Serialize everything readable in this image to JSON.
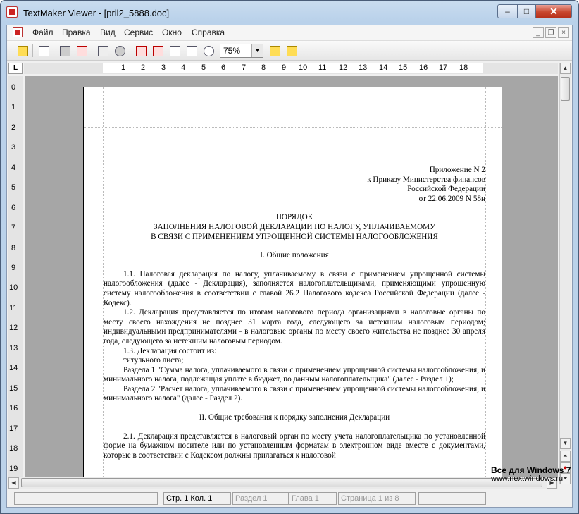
{
  "window": {
    "title": "TextMaker Viewer - [pril2_5888.doc]",
    "min": "–",
    "max": "□",
    "close": "✕"
  },
  "menu": [
    "Файл",
    "Правка",
    "Вид",
    "Сервис",
    "Окно",
    "Справка"
  ],
  "mdi": {
    "min": "_",
    "restore": "❐",
    "close": "×"
  },
  "toolbar": {
    "zoom": "75%",
    "icons": [
      "open-icon",
      "new-page-icon",
      "print-icon",
      "pdf-icon",
      "copy-icon",
      "find-icon",
      "single-page-icon",
      "two-page-icon",
      "page-width-icon",
      "multi-page-icon",
      "zoom-icon",
      "ruler-h-icon",
      "ruler-v-icon"
    ]
  },
  "ruler": {
    "corner": "L",
    "h": [
      "1",
      "2",
      "3",
      "4",
      "5",
      "6",
      "7",
      "8",
      "9",
      "10",
      "11",
      "12",
      "13",
      "14",
      "15",
      "16",
      "17",
      "18"
    ],
    "v": [
      "0",
      "1",
      "2",
      "3",
      "4",
      "5",
      "6",
      "7",
      "8",
      "9",
      "10",
      "11",
      "12",
      "13",
      "14",
      "15",
      "16",
      "17",
      "18",
      "19"
    ]
  },
  "doc": {
    "appendix": [
      "Приложение N 2",
      "к Приказу Министерства финансов",
      "Российской Федерации",
      "от 22.06.2009 N 58н"
    ],
    "title": [
      "ПОРЯДОК",
      "ЗАПОЛНЕНИЯ НАЛОГОВОЙ ДЕКЛАРАЦИИ ПО НАЛОГУ, УПЛАЧИВАЕМОМУ",
      "В СВЯЗИ С ПРИМЕНЕНИЕМ УПРОЩЕННОЙ СИСТЕМЫ НАЛОГООБЛОЖЕНИЯ"
    ],
    "section1": "I. Общие положения",
    "p1_1": "1.1. Налоговая декларация по налогу, уплачиваемому в связи с применением упрощенной системы налогообложения (далее - Декларация), заполняется налогоплательщиками, применяющими упрощенную систему налогообложения в соответствии с главой 26.2 Налогового кодекса Российской Федерации (далее - Кодекс).",
    "p1_2": "1.2. Декларация представляется по итогам налогового периода организациями в налоговые органы по месту своего нахождения не позднее 31 марта года, следующего за истекшим налоговым периодом; индивидуальными предпринимателями - в налоговые органы по месту своего жительства не позднее 30 апреля года, следующего за истекшим налоговым периодом.",
    "p1_3": "1.3. Декларация состоит из:",
    "p1_3a": "титульного листа;",
    "p1_3b": "Раздела 1 \"Сумма налога, уплачиваемого в связи с применением упрощенной системы налогообложения, и минимального налога, подлежащая уплате в бюджет, по данным налогоплательщика\" (далее - Раздел 1);",
    "p1_3c": "Раздела 2 \"Расчет налога, уплачиваемого в связи с применением упрощенной системы налогообложения, и минимального налога\" (далее - Раздел 2).",
    "section2": "II. Общие требования к порядку заполнения Декларации",
    "p2_1": "2.1. Декларация представляется в налоговый орган по месту учета налогоплательщика по установленной форме на бумажном носителе или по установленным форматам в электронном виде вместе с документами, которые в соответствии с Кодексом должны прилагаться к налоговой"
  },
  "status": {
    "pos": "Стр. 1 Кол. 1",
    "section": "Раздел 1",
    "chapter": "Глава 1",
    "page": "Страница 1 из 8"
  },
  "watermark": {
    "line1": "Все для Windows 7",
    "line2": "www.nextwindows.ru"
  }
}
